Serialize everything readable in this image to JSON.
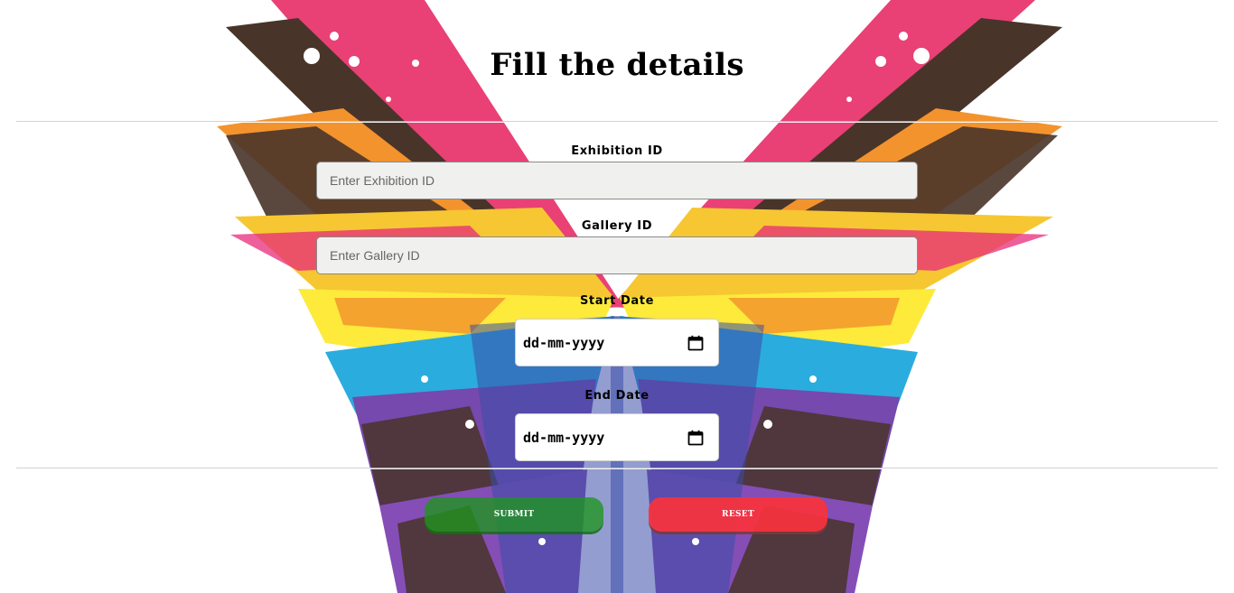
{
  "form": {
    "title": "Fill the details",
    "fields": [
      {
        "label": "Exhibition ID",
        "placeholder": "Enter Exhibition ID",
        "value": ""
      },
      {
        "label": "Gallery ID",
        "placeholder": "Enter Gallery ID",
        "value": ""
      },
      {
        "label": "Start Date",
        "value": "dd-mm-yyyy",
        "icon": "calendar-icon"
      },
      {
        "label": "End Date",
        "value": "dd-mm-yyyy",
        "icon": "calendar-icon"
      }
    ],
    "buttons": {
      "submit": "SUBMIT",
      "reset": "RESET"
    }
  },
  "colors": {
    "submit": "#1e961e",
    "reset": "#fa323c",
    "input_bg": "#f0f0ee"
  }
}
